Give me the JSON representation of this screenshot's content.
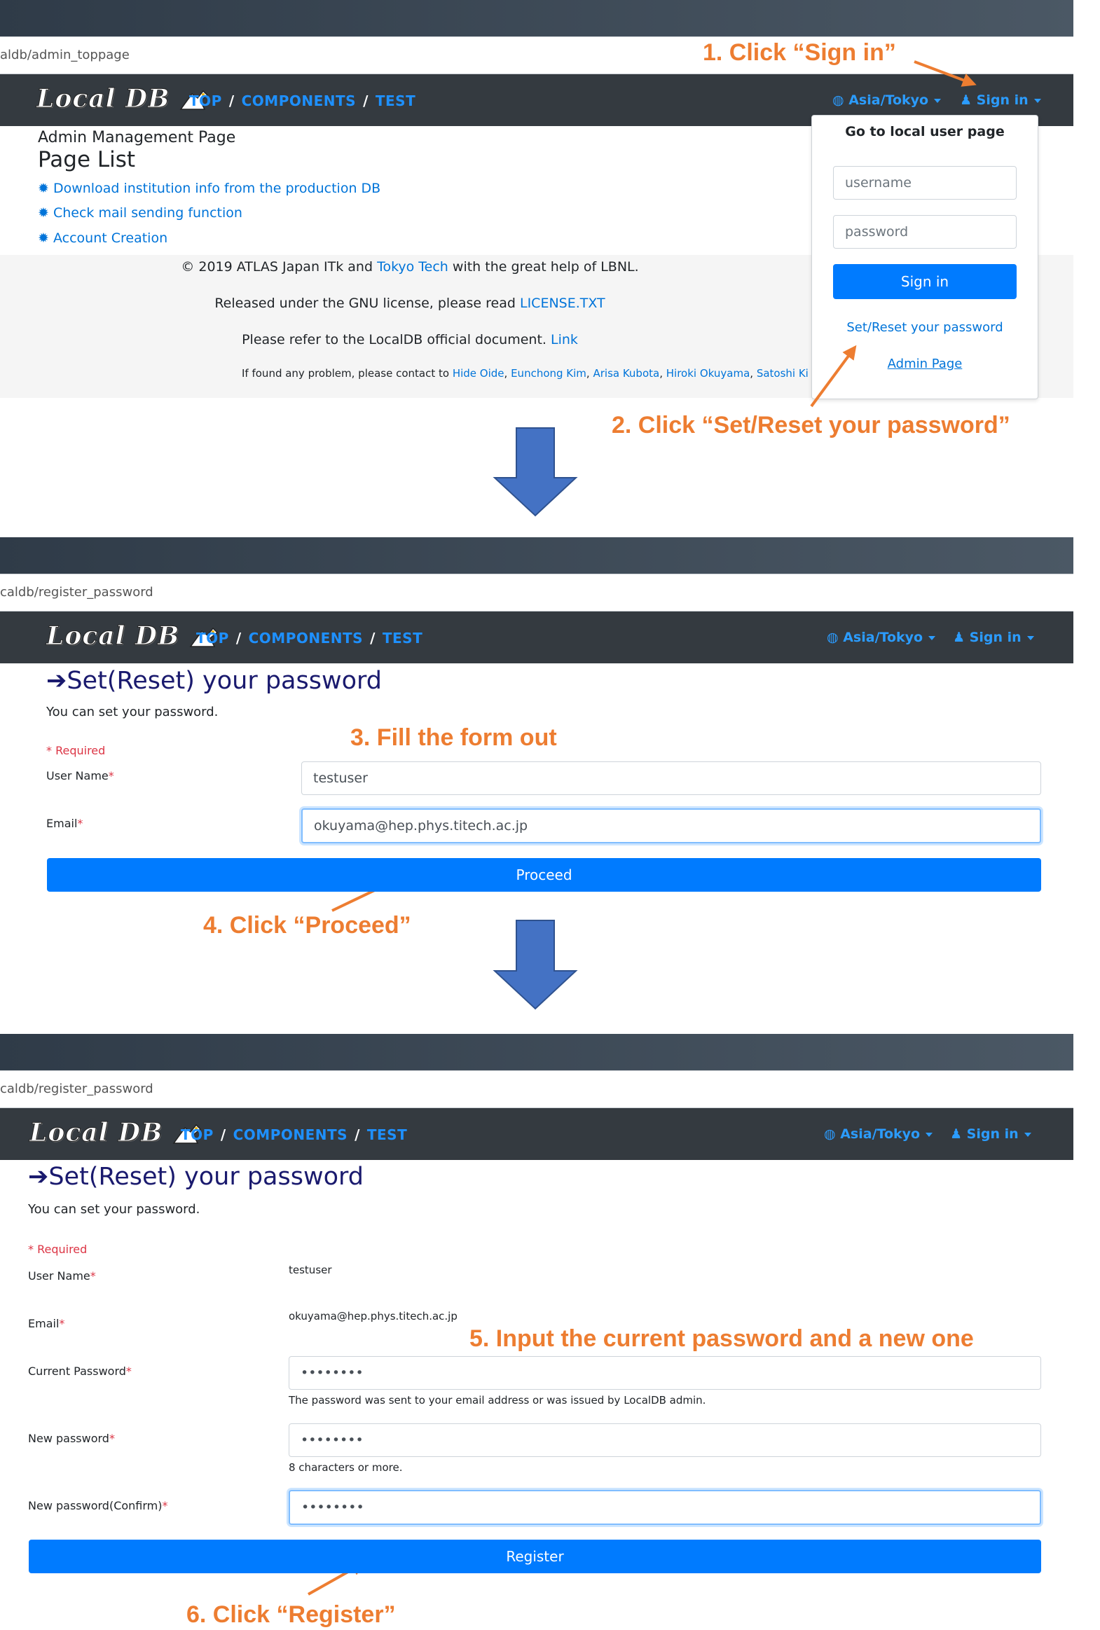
{
  "colors": {
    "annotation": "#ed7d31",
    "accent": "#007bff",
    "navbar": "#343a40",
    "arrow": "#4472c4"
  },
  "common": {
    "logo_text": "Local DB",
    "nav": {
      "top": "TOP",
      "components": "COMPONENTS",
      "test": "TEST",
      "sep": "/"
    },
    "timezone": "Asia/Tokyo",
    "signin": "Sign in"
  },
  "step1": {
    "url": "aldb/admin_toppage",
    "admin_title": "Admin Management Page",
    "page_list_title": "Page List",
    "links": [
      "Download institution info from the production DB",
      "Check mail sending function",
      "Account Creation"
    ],
    "footer": {
      "line1_a": "© 2019 ATLAS Japan ITk and ",
      "line1_link": "Tokyo Tech",
      "line1_b": " with the great help of LBNL.",
      "line2_a": "Released under the GNU license, please read ",
      "line2_link": "LICENSE.TXT",
      "line3_a": "Please refer to the LocalDB official document. ",
      "line3_link": "Link",
      "line4_a": "If found any problem, please contact to ",
      "contacts": [
        "Hide Oide",
        "Eunchong Kim",
        "Arisa Kubota",
        "Hiroki Okuyama",
        "Satoshi Ki"
      ]
    },
    "dropdown": {
      "title": "Go to local user page",
      "username_placeholder": "username",
      "password_placeholder": "password",
      "signin_button": "Sign in",
      "reset_link": "Set/Reset your password",
      "admin_link": "Admin Page"
    }
  },
  "step2": {
    "url": "caldb/register_password",
    "title": "Set(Reset) your password",
    "subtitle": "You can set your password.",
    "required": "* Required",
    "username_label": "User Name",
    "email_label": "Email",
    "star": "*",
    "username_value": "testuser",
    "email_value": "okuyama@hep.phys.titech.ac.jp",
    "proceed": "Proceed"
  },
  "step3": {
    "url": "caldb/register_password",
    "title": "Set(Reset) your password",
    "subtitle": "You can set your password.",
    "required": "* Required",
    "username_label": "User Name",
    "username_value": "testuser",
    "email_label": "Email",
    "email_value": "okuyama@hep.phys.titech.ac.jp",
    "current_label": "Current Password",
    "current_value": "••••••••",
    "current_help": "The password was sent to your email address or was issued by LocalDB admin.",
    "new_label": "New password",
    "new_value": "••••••••",
    "new_help": "8 characters or more.",
    "confirm_label": "New password(Confirm)",
    "confirm_value": "••••••••",
    "star": "*",
    "register": "Register"
  },
  "annotations": {
    "a1": "1. Click “Sign in”",
    "a2": "2. Click “Set/Reset your password”",
    "a3": "3. Fill the form out",
    "a4": "4. Click “Proceed”",
    "a5": "5. Input the current password and a new one",
    "a6": "6. Click “Register”"
  }
}
